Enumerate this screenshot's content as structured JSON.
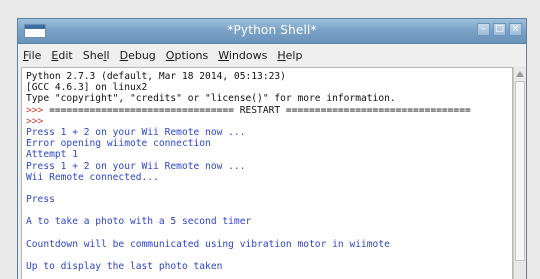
{
  "window": {
    "title": "*Python Shell*",
    "controls": {
      "minimize": "–",
      "maximize": "□",
      "close": "×"
    }
  },
  "menu": {
    "items": [
      {
        "mnemonic": "F",
        "rest": "ile"
      },
      {
        "mnemonic": "E",
        "rest": "dit"
      },
      {
        "pre": "She",
        "mnemonic": "l",
        "rest": "l"
      },
      {
        "mnemonic": "D",
        "rest": "ebug"
      },
      {
        "mnemonic": "O",
        "rest": "ptions"
      },
      {
        "mnemonic": "W",
        "rest": "indows"
      },
      {
        "mnemonic": "H",
        "rest": "elp"
      }
    ]
  },
  "shell": {
    "lines": [
      {
        "text": "Python 2.7.3 (default, Mar 18 2014, 05:13:23)",
        "color": "#111111"
      },
      {
        "text": "[GCC 4.6.3] on linux2",
        "color": "#111111"
      },
      {
        "text": "Type \"copyright\", \"credits\" or \"license()\" for more information.",
        "color": "#111111"
      },
      {
        "text": ">>> ================================ RESTART ================================",
        "color": "#111111",
        "prompt": ">>>"
      },
      {
        "text": ">>>",
        "color": "#d23a2e"
      },
      {
        "text": "Press 1 + 2 on your Wii Remote now ...",
        "color": "#2f45c8"
      },
      {
        "text": "Error opening wiimote connection",
        "color": "#2f45c8"
      },
      {
        "text": "Attempt 1",
        "color": "#2f45c8"
      },
      {
        "text": "Press 1 + 2 on your Wii Remote now ...",
        "color": "#2f45c8"
      },
      {
        "text": "Wii Remote connected...",
        "color": "#2f45c8"
      },
      {
        "text": "",
        "color": "#2f45c8"
      },
      {
        "text": "Press",
        "color": "#2f45c8"
      },
      {
        "text": "",
        "color": "#2f45c8"
      },
      {
        "text": "A to take a photo with a 5 second timer",
        "color": "#2f45c8"
      },
      {
        "text": "",
        "color": "#2f45c8"
      },
      {
        "text": "Countdown will be communicated using vibration motor in wiimote",
        "color": "#2f45c8"
      },
      {
        "text": "",
        "color": "#2f45c8"
      },
      {
        "text": "Up to display the last photo taken",
        "color": "#2f45c8"
      }
    ]
  },
  "colors": {
    "titlebar": "#7ca3c7",
    "prompt_red": "#d23a2e",
    "output_blue": "#2f45c8",
    "text_black": "#111111"
  }
}
